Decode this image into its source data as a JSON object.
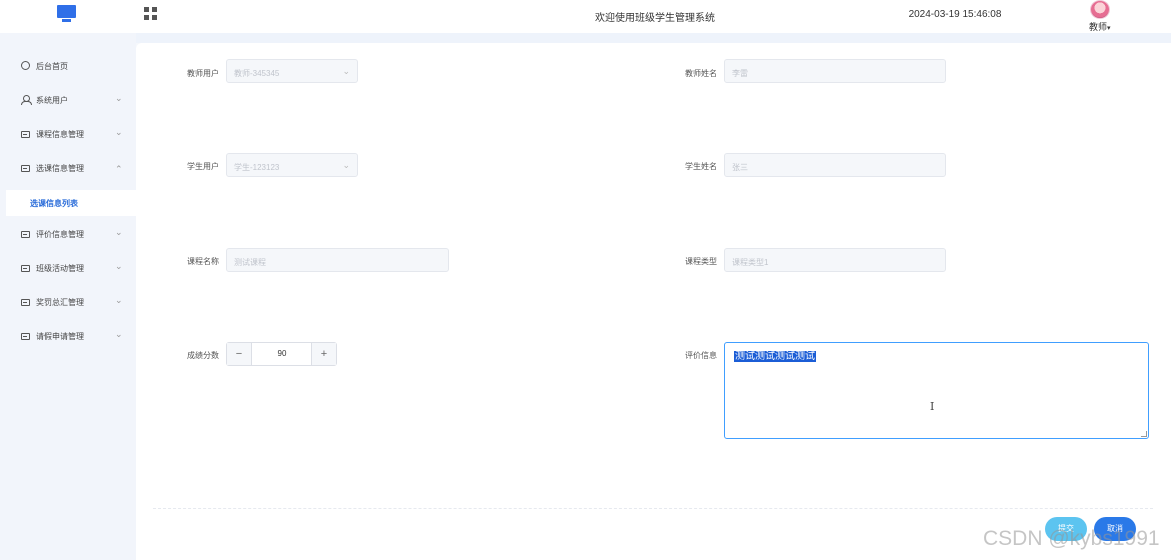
{
  "header": {
    "logo_icon": "monitor-icon",
    "menu_icon": "grid-icon",
    "welcome": "欢迎使用班级学生管理系统",
    "datetime": "2024-03-19 15:46:08",
    "user_role": "教师",
    "user_caret": "▾"
  },
  "sidebar": {
    "items": [
      {
        "label": "后台首页",
        "icon": "clock-icon"
      },
      {
        "label": "系统用户",
        "icon": "user-icon",
        "chevron": "⌄"
      },
      {
        "label": "课程信息管理",
        "icon": "window-icon",
        "chevron": "⌄"
      },
      {
        "label": "选课信息管理",
        "icon": "window-icon",
        "chevron": "⌃"
      },
      {
        "label": "评价信息管理",
        "icon": "window-icon",
        "chevron": "⌄"
      },
      {
        "label": "班级活动管理",
        "icon": "window-icon",
        "chevron": "⌄"
      },
      {
        "label": "奖罚总汇管理",
        "icon": "window-icon",
        "chevron": "⌄"
      },
      {
        "label": "请假申请管理",
        "icon": "window-icon",
        "chevron": "⌄"
      }
    ],
    "active_sub": "选课信息列表"
  },
  "form": {
    "teacher_user": {
      "label": "教师用户",
      "value": "教师-345345"
    },
    "teacher_name": {
      "label": "教师姓名",
      "value": "李雷"
    },
    "student_user": {
      "label": "学生用户",
      "value": "学生-123123"
    },
    "student_name": {
      "label": "学生姓名",
      "value": "张三"
    },
    "course_name": {
      "label": "课程名称",
      "value": "测试课程"
    },
    "course_type": {
      "label": "课程类型",
      "value": "课程类型1"
    },
    "score": {
      "label": "成绩分数",
      "value": "90",
      "minus": "−",
      "plus": "+"
    },
    "evaluation": {
      "label": "评价信息",
      "value": "测试测试测试测试"
    },
    "select_arrow": "⌄"
  },
  "actions": {
    "submit": "提交",
    "cancel": "取消"
  },
  "watermark": "CSDN @kybs1991",
  "colors": {
    "accent": "#2a79e8",
    "submit": "#5cc4f0",
    "active_menu_text": "#2a6cd9"
  }
}
